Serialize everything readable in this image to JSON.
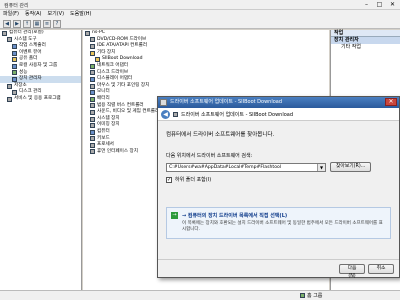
{
  "window": {
    "title": "컴퓨터 관리"
  },
  "menu": [
    "파일(F)",
    "동작(A)",
    "보기(V)",
    "도움말(H)"
  ],
  "toolbar_icons": [
    "back-icon",
    "forward-icon",
    "up-icon",
    "show-hide-tree-icon",
    "properties-icon",
    "help-icon"
  ],
  "left_tree": [
    {
      "label": "컴퓨터 관리(로컬)",
      "icon": "computer-management-icon",
      "indent": 0,
      "color": "s"
    },
    {
      "label": "시스템 도구",
      "icon": "tools-icon",
      "indent": 1,
      "color": "s"
    },
    {
      "label": "작업 스케줄러",
      "icon": "clock-icon",
      "indent": 2,
      "color": "b"
    },
    {
      "label": "이벤트 뷰어",
      "icon": "event-icon",
      "indent": 2,
      "color": "b"
    },
    {
      "label": "공유 폴더",
      "icon": "folder-icon",
      "indent": 2,
      "color": "y"
    },
    {
      "label": "로컬 사용자 및 그룹",
      "icon": "users-icon",
      "indent": 2,
      "color": "b"
    },
    {
      "label": "성능",
      "icon": "performance-icon",
      "indent": 2,
      "color": "g"
    },
    {
      "label": "장치 관리자",
      "icon": "device-manager-icon",
      "indent": 2,
      "color": "b",
      "selected": true
    },
    {
      "label": "저장소",
      "icon": "storage-icon",
      "indent": 1,
      "color": "s"
    },
    {
      "label": "디스크 관리",
      "icon": "disk-icon",
      "indent": 2,
      "color": "s"
    },
    {
      "label": "서비스 및 응용 프로그램",
      "icon": "services-icon",
      "indent": 1,
      "color": "s"
    }
  ],
  "device_tree": [
    {
      "label": "ns-PC",
      "indent": 0,
      "color": "s"
    },
    {
      "label": "DVD/CD-ROM 드라이브",
      "indent": 1,
      "color": "s"
    },
    {
      "label": "IDE ATA/ATAPI 컨트롤러",
      "indent": 1,
      "color": "s"
    },
    {
      "label": "기타 장치",
      "indent": 1,
      "color": "y"
    },
    {
      "label": "SIIBoot Download",
      "indent": 2,
      "color": "y"
    },
    {
      "label": "네트워크 어댑터",
      "indent": 1,
      "color": "g"
    },
    {
      "label": "디스크 드라이브",
      "indent": 1,
      "color": "s"
    },
    {
      "label": "디스플레이 어댑터",
      "indent": 1,
      "color": "b"
    },
    {
      "label": "마우스 및 기타 포인팅 장치",
      "indent": 1,
      "color": "s"
    },
    {
      "label": "모니터",
      "indent": 1,
      "color": "b"
    },
    {
      "label": "배터리",
      "indent": 1,
      "color": "g"
    },
    {
      "label": "범용 직렬 버스 컨트롤러",
      "indent": 1,
      "color": "s"
    },
    {
      "label": "사운드, 비디오 및 게임 컨트롤러",
      "indent": 1,
      "color": "s"
    },
    {
      "label": "시스템 장치",
      "indent": 1,
      "color": "s"
    },
    {
      "label": "이미징 장치",
      "indent": 1,
      "color": "s"
    },
    {
      "label": "컴퓨터",
      "indent": 1,
      "color": "b"
    },
    {
      "label": "키보드",
      "indent": 1,
      "color": "s"
    },
    {
      "label": "프로세서",
      "indent": 1,
      "color": "s"
    },
    {
      "label": "휴먼 인터페이스 장치",
      "indent": 1,
      "color": "s"
    }
  ],
  "actions": {
    "header": "작업",
    "section": "장치 관리자",
    "items": [
      "기타 작업"
    ]
  },
  "dialog": {
    "title": "드라이버 소프트웨어 업데이트 - SIIBoot Download",
    "subheader": "드라이버 소프트웨어 업데이트 - SIIBoot Download",
    "heading": "컴퓨터에서 드라이버 소프트웨어를 찾아봅니다.",
    "search_label": "다음 위치에서 드라이버 소프트웨어 검색:",
    "path_value": "C:#Users#wa#AppData#Local#Temp#Flashtool",
    "browse_label": "찾아보기(R)...",
    "include_subfolders_label": "하위 폴더 포함(I)",
    "include_subfolders_checked": true,
    "option_title": "→ 컴퓨터의 장치 드라이버 목록에서 직접 선택(L)",
    "option_desc": "이 목록에는 장치와 호환되는 설치 드라이버 소프트웨어 및 동일한 범주에서 모든 드라이버 소프트웨어를 표시합니다.",
    "next_label": "다음(N)",
    "cancel_label": "취소"
  },
  "statusbar": {
    "text": ""
  },
  "taskbar_hint": "홈 그룹"
}
